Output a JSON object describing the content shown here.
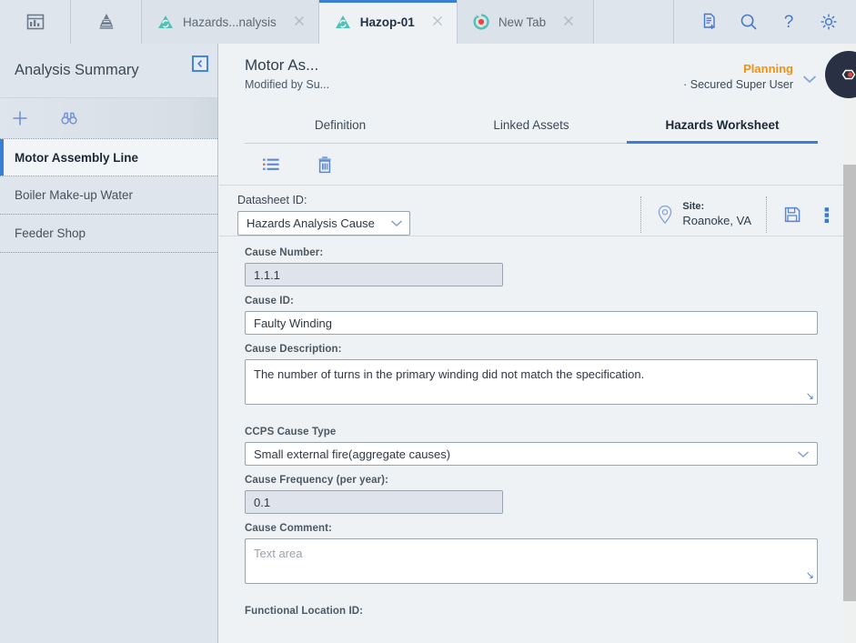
{
  "tabbar": {
    "left_icons": [
      {
        "name": "dashboard-icon",
        "label": "Dashboard"
      },
      {
        "name": "pyramid-icon",
        "label": "Risk Matrix"
      }
    ],
    "tabs": [
      {
        "label": "Hazards...nalysis",
        "active": false,
        "icon": "hazards-analysis-icon"
      },
      {
        "label": "Hazop-01",
        "active": true,
        "icon": "hazards-analysis-icon"
      },
      {
        "label": "New Tab",
        "active": false,
        "icon": "new-tab-icon"
      }
    ],
    "close_label": "✕",
    "right_icons": [
      {
        "name": "new-document-icon",
        "label": "New"
      },
      {
        "name": "search-icon",
        "label": "Search"
      },
      {
        "name": "help-icon",
        "label": "Help"
      },
      {
        "name": "settings-icon",
        "label": "Settings"
      }
    ],
    "help_glyph": "?"
  },
  "sidebar": {
    "title": "Analysis Summary",
    "collapse_glyph": "‹",
    "tools": [
      {
        "name": "add-icon",
        "label": "Add"
      },
      {
        "name": "binoculars-icon",
        "label": "Search"
      }
    ],
    "items": [
      {
        "label": "Motor Assembly Line",
        "selected": true
      },
      {
        "label": "Boiler Make-up Water",
        "selected": false
      },
      {
        "label": "Feeder Shop",
        "selected": false
      }
    ]
  },
  "header": {
    "title": "Motor As...",
    "subtitle": "Modified by Su...",
    "status": "Planning",
    "status_color": "#f29111",
    "user": "· Secured Super User",
    "caret_glyph": "∨"
  },
  "page_tabs": [
    {
      "label": "Definition",
      "active": false
    },
    {
      "label": "Linked Assets",
      "active": false
    },
    {
      "label": "Hazards Worksheet",
      "active": true
    }
  ],
  "worksheet_tools": [
    {
      "name": "list-view-icon",
      "label": "List View"
    },
    {
      "name": "delete-icon",
      "label": "Delete"
    }
  ],
  "datasheet": {
    "label": "Datasheet ID:",
    "value": "Hazards Analysis Cause",
    "caret_glyph": "⌄",
    "site_key": "Site:",
    "site_value": "Roanoke, VA",
    "save_label": "Save",
    "more_label": "More options"
  },
  "form": {
    "fields": [
      {
        "key": "cause_number",
        "label": "Cause Number:",
        "value": "1.1.1",
        "type": "input-readonly"
      },
      {
        "key": "cause_id",
        "label": "Cause ID:",
        "value": "Faulty Winding",
        "type": "input"
      },
      {
        "key": "cause_description",
        "label": "Cause Description:",
        "value": "The number of turns in the primary winding did not match the specification.",
        "type": "textarea"
      },
      {
        "key": "ccps_cause_type",
        "label": "CCPS Cause Type",
        "value": "Small external fire(aggregate causes)",
        "type": "select"
      },
      {
        "key": "cause_frequency",
        "label": "Cause Frequency (per year):",
        "value": "0.1",
        "type": "input-readonly"
      },
      {
        "key": "cause_comment",
        "label": "Cause Comment:",
        "value": "",
        "placeholder": "Text area",
        "type": "textarea"
      },
      {
        "key": "functional_location_id",
        "label": "Functional Location ID:",
        "value": "",
        "type": "label-only"
      }
    ],
    "resize_glyph": "↘"
  },
  "fab": {
    "name": "feedback-icon",
    "label": "Feedback"
  },
  "colors": {
    "accent_blue": "#3a7fd5",
    "status_orange": "#f29111",
    "tabbar_bg": "#dfe5ec",
    "content_bg": "#eef2f5",
    "teal_icon": "#45b6ad"
  }
}
